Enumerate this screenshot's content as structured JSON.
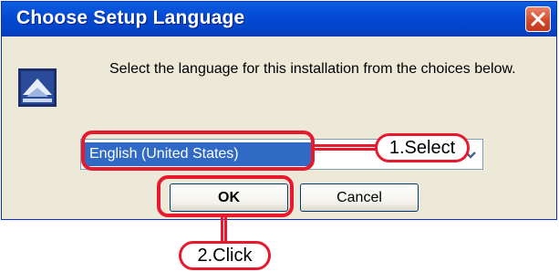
{
  "window": {
    "title": "Choose Setup Language",
    "close_icon": "close-icon"
  },
  "dialog": {
    "icon": "setup-icon",
    "message": "Select the language for this installation from the choices below.",
    "language_select": {
      "selected_value": "English (United States)",
      "arrow_icon": "chevron-down-icon"
    },
    "buttons": {
      "ok_label": "OK",
      "cancel_label": "Cancel"
    }
  },
  "annotations": {
    "select_callout": "1.Select",
    "click_callout": "2.Click",
    "color": "#e8192c"
  },
  "colors": {
    "titlebar": "#0349d3",
    "dialog_bg": "#ece9d8",
    "selection": "#316ac5"
  }
}
